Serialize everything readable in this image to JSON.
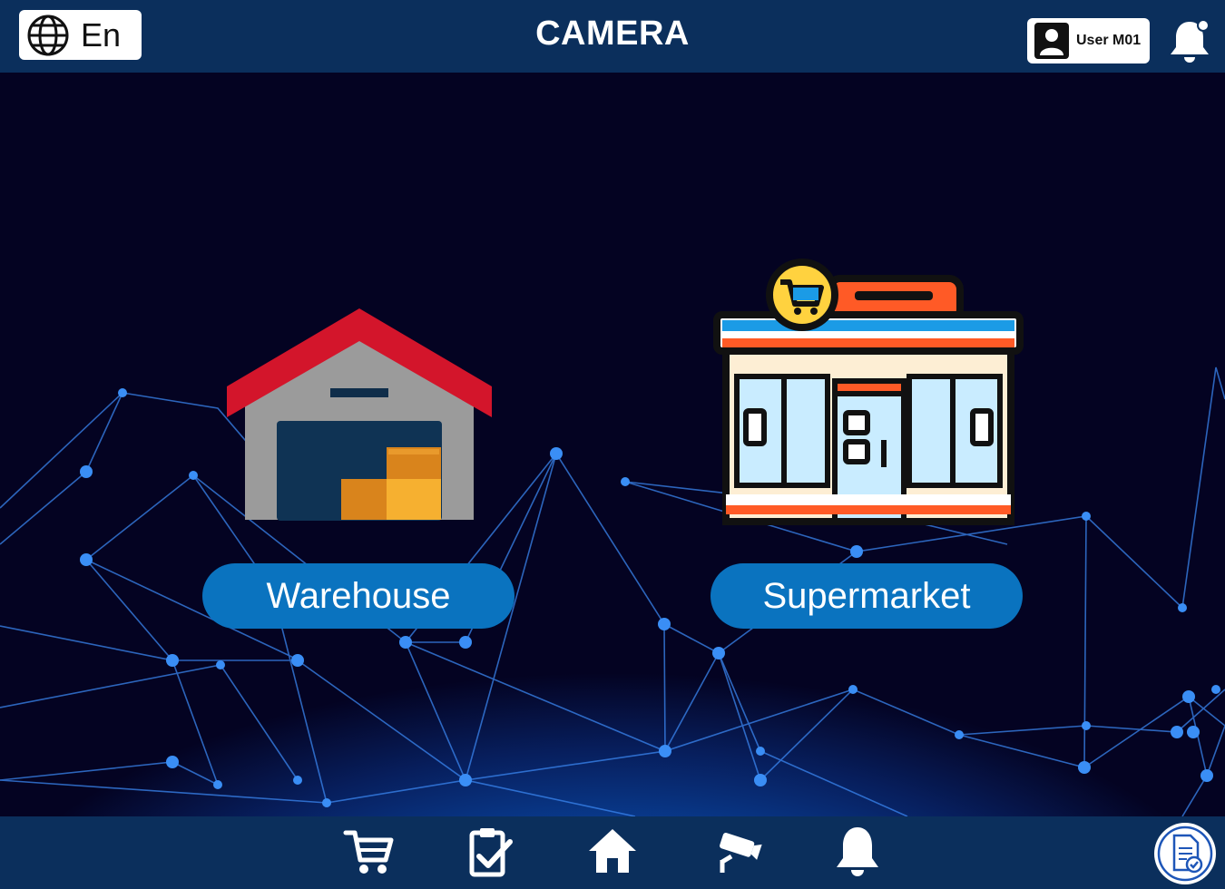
{
  "header": {
    "language": "En",
    "title": "CAMERA",
    "user_label": "User M01",
    "language_icon": "globe-icon",
    "user_icon": "user-avatar-icon",
    "notification_icon": "bell-icon"
  },
  "main": {
    "tiles": [
      {
        "label": "Warehouse",
        "icon": "warehouse-icon"
      },
      {
        "label": "Supermarket",
        "icon": "supermarket-icon"
      }
    ]
  },
  "bottom_nav": {
    "items": [
      {
        "icon": "cart-icon"
      },
      {
        "icon": "task-checklist-icon"
      },
      {
        "icon": "home-icon"
      },
      {
        "icon": "security-camera-icon"
      },
      {
        "icon": "bell-icon"
      },
      {
        "icon": "report-document-icon"
      }
    ]
  },
  "colors": {
    "header_bg": "#0b2f5c",
    "button_blue": "#0a73bf",
    "background_dark": "#040322",
    "network_line": "#2f7ff0"
  }
}
